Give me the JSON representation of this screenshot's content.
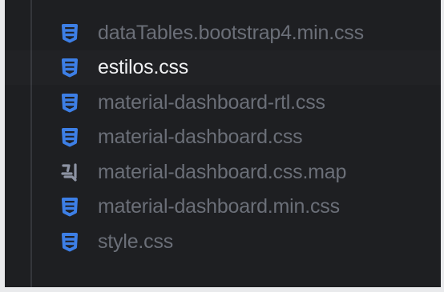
{
  "explorer": {
    "files": [
      {
        "name": "dataTables.bootstrap4.min.css",
        "icon": "css-file-icon",
        "selected": false
      },
      {
        "name": "estilos.css",
        "icon": "css-file-icon",
        "selected": true
      },
      {
        "name": "material-dashboard-rtl.css",
        "icon": "css-file-icon",
        "selected": false
      },
      {
        "name": "material-dashboard.css",
        "icon": "css-file-icon",
        "selected": false
      },
      {
        "name": "material-dashboard.css.map",
        "icon": "source-map-file-icon",
        "selected": false
      },
      {
        "name": "material-dashboard.min.css",
        "icon": "css-file-icon",
        "selected": false
      },
      {
        "name": "style.css",
        "icon": "css-file-icon",
        "selected": false
      }
    ]
  },
  "colors": {
    "background": "#1e1f22",
    "css_icon": "#3d7fe6",
    "map_icon": "#8d93a3",
    "text_default": "#6b6f78",
    "text_selected": "#f0f1f3"
  }
}
